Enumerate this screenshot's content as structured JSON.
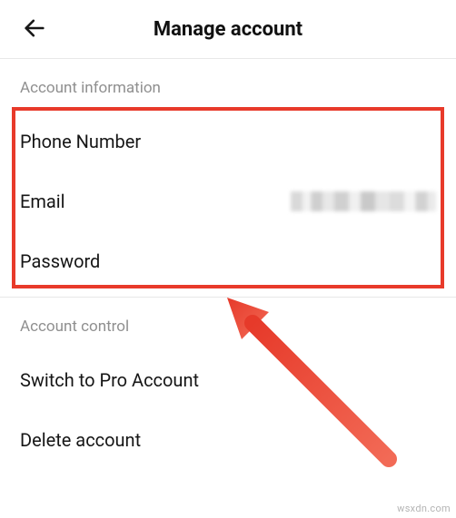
{
  "header": {
    "title": "Manage account"
  },
  "sections": {
    "info": {
      "header": "Account information",
      "phone": "Phone Number",
      "email": "Email",
      "password": "Password"
    },
    "control": {
      "header": "Account control",
      "switch_pro": "Switch to Pro Account",
      "delete": "Delete account"
    }
  },
  "annotation": {
    "highlight_color": "#e83a2a",
    "arrow_color": "#ec4437"
  },
  "watermark": "wsxdn.com"
}
